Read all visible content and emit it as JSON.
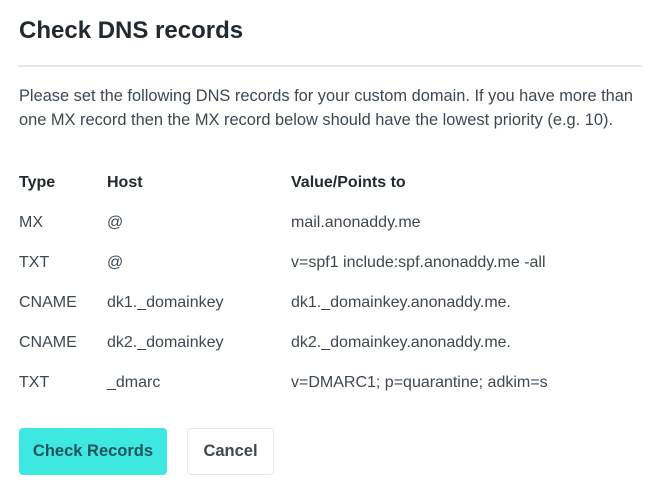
{
  "dialog": {
    "title": "Check DNS records",
    "description": "Please set the following DNS records for your custom domain. If you have more than one MX record then the MX record below should have the lowest priority (e.g. 10).",
    "table": {
      "headers": [
        "Type",
        "Host",
        "Value/Points to"
      ],
      "rows": [
        [
          "MX",
          "@",
          "mail.anonaddy.me"
        ],
        [
          "TXT",
          "@",
          "v=spf1 include:spf.anonaddy.me -all"
        ],
        [
          "CNAME",
          "dk1._domainkey",
          "dk1._domainkey.anonaddy.me."
        ],
        [
          "CNAME",
          "dk2._domainkey",
          "dk2._domainkey.anonaddy.me."
        ],
        [
          "TXT",
          "_dmarc",
          "v=DMARC1; p=quarantine; adkim=s"
        ]
      ]
    },
    "buttons": {
      "check": "Check Records",
      "cancel": "Cancel"
    },
    "colors": {
      "primary_button": "#3ce8e0",
      "primary_button_text": "#22545e"
    }
  }
}
